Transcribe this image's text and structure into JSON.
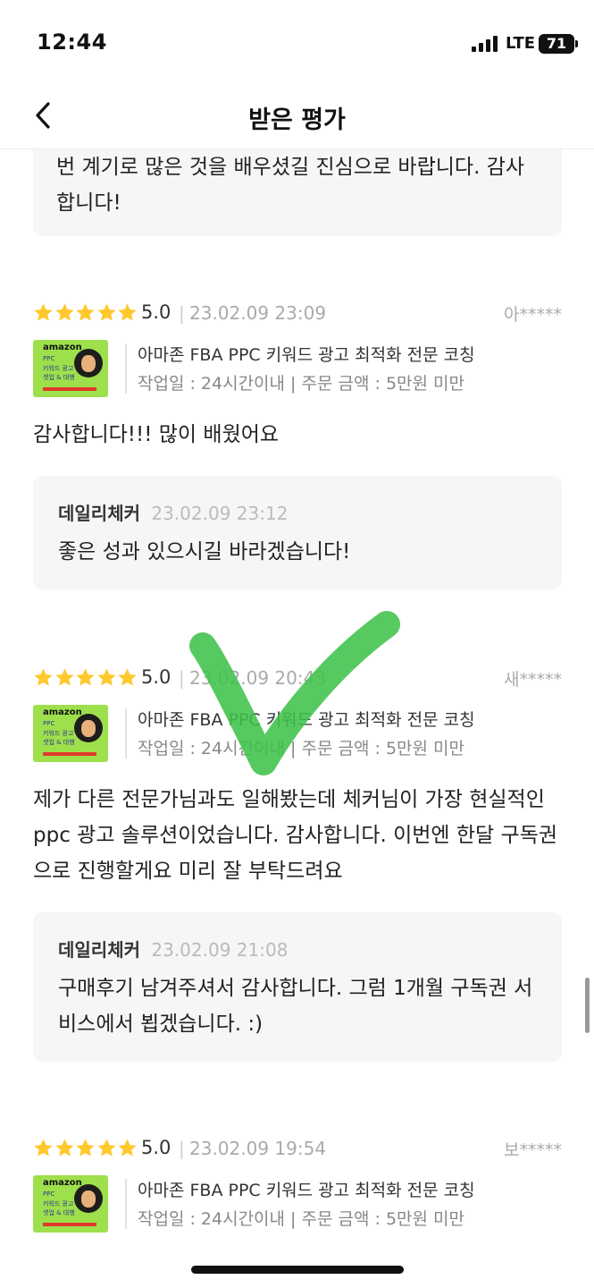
{
  "status_bar": {
    "time": "12:44",
    "network": "LTE",
    "battery": "71"
  },
  "header": {
    "title": "받은 평가",
    "back_icon": "chevron-left-icon"
  },
  "top_reply": {
    "text": "번 계기로 많은 것을 배우셨길 진심으로 바랍니다. 감사합니다!"
  },
  "thumbnail": {
    "brand": "amazon",
    "line1": "PPC",
    "line2": "키워드 광고",
    "line3": "셋업 & 대행"
  },
  "reviews": [
    {
      "score": "5.0",
      "date": "23.02.09 23:09",
      "user": "아*****",
      "product_title": "아마존 FBA PPC 키워드 광고 최적화 전문 코칭",
      "product_meta": "작업일 : 24시간이내 | 주문 금액 : 5만원 미만",
      "text": "감사합니다!!! 많이 배웠어요",
      "reply": {
        "name": "데일리체커",
        "date": "23.02.09 23:12",
        "text": "좋은 성과 있으시길 바라겠습니다!"
      }
    },
    {
      "score": "5.0",
      "date": "23.02.09 20:43",
      "user": "새*****",
      "product_title": "아마존 FBA PPC 키워드 광고 최적화 전문 코칭",
      "product_meta": "작업일 : 24시간이내 | 주문 금액 : 5만원 미만",
      "text": "제가 다른 전문가님과도 일해봤는데 체커님이 가장 현실적인 ppc 광고 솔루션이었습니다. 감사합니다. 이번엔 한달 구독권으로 진행할게요 미리 잘 부탁드려요",
      "reply": {
        "name": "데일리체커",
        "date": "23.02.09 21:08",
        "text": "구매후기 남겨주셔서 감사합니다. 그럼 1개월 구독권 서비스에서 뵙겠습니다. :)"
      }
    },
    {
      "score": "5.0",
      "date": "23.02.09 19:54",
      "user": "보*****",
      "product_title": "아마존 FBA PPC 키워드 광고 최적화 전문 코칭",
      "product_meta": "작업일 : 24시간이내 | 주문 금액 : 5만원 미만"
    }
  ],
  "colors": {
    "star": "#ffc82c",
    "reply_bg": "#f6f6f8",
    "check_mark": "#3fc24a"
  }
}
